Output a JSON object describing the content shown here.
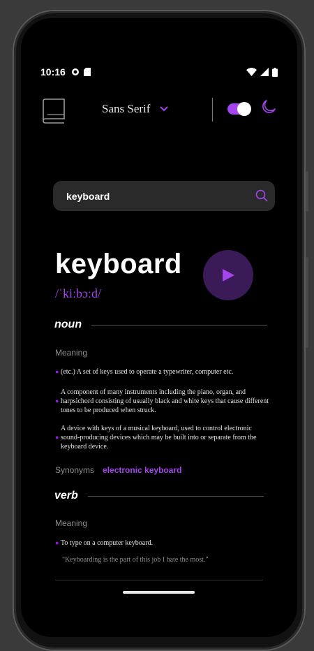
{
  "status": {
    "time": "10:16"
  },
  "header": {
    "font_label": "Sans Serif",
    "theme_dark": true
  },
  "search": {
    "value": "keyboard",
    "placeholder": ""
  },
  "word": {
    "title": "keyboard",
    "phonetic": "/ˈkiːbɔːd/"
  },
  "noun": {
    "pos": "noun",
    "meaning_label": "Meaning",
    "definitions": [
      "(etc.) A set of keys used to operate a typewriter, computer etc.",
      "A component of many instruments including the piano, organ, and harpsichord consisting of usually black and white keys that cause different tones to be produced when struck.",
      "A device with keys of a musical keyboard, used to control electronic sound-producing devices which may be built into or separate from the keyboard device."
    ],
    "synonyms_label": "Synonyms",
    "synonyms_value": "electronic keyboard"
  },
  "verb": {
    "pos": "verb",
    "meaning_label": "Meaning",
    "definitions": [
      "To type on a computer keyboard."
    ],
    "example": "\"Keyboarding is the part of this job I hate the most.\""
  },
  "colors": {
    "accent": "#a445ed",
    "background": "#000000",
    "search_bg": "#2a2a2a"
  },
  "icons": [
    "book-icon",
    "chevron-down-icon",
    "moon-icon",
    "search-icon",
    "play-icon",
    "wifi-icon",
    "signal-icon",
    "battery-icon"
  ]
}
